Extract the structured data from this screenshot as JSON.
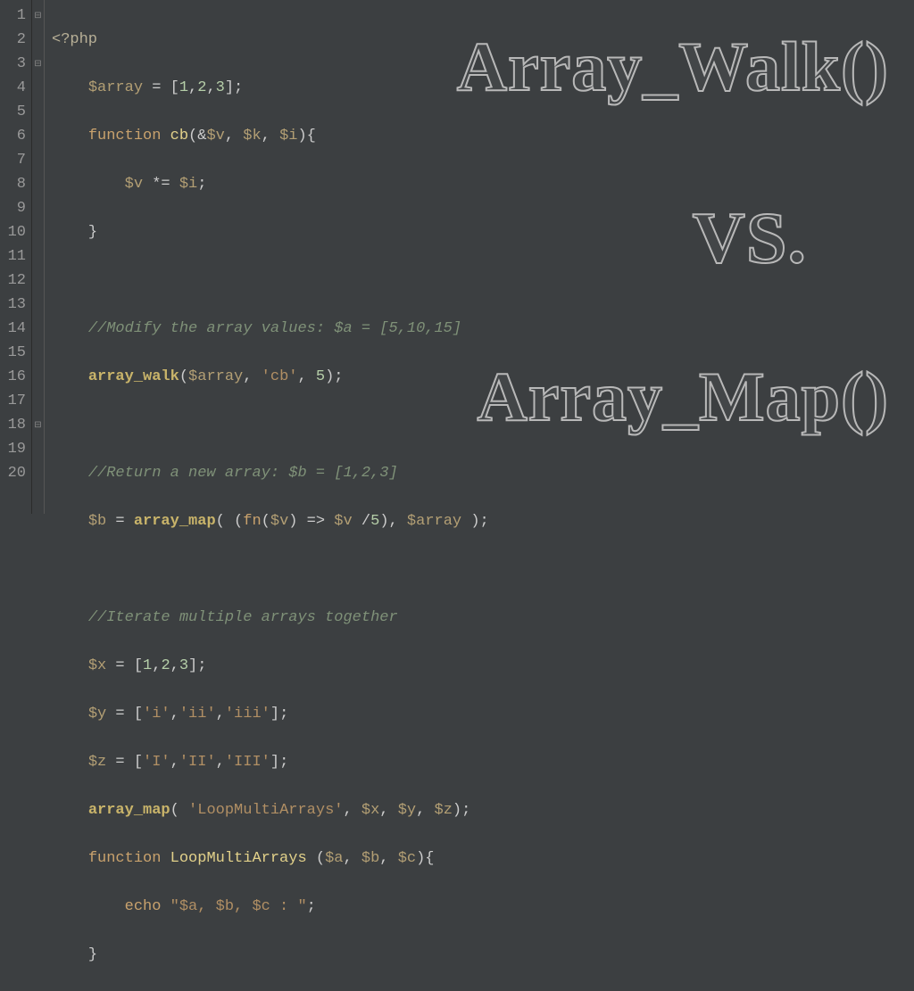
{
  "overlay": {
    "l1": "Array_Walk()",
    "l2": "VS.",
    "l3": "Array_Map()"
  },
  "gutter": [
    "1",
    "2",
    "3",
    "4",
    "5",
    "6",
    "7",
    "8",
    "9",
    "10",
    "11",
    "12",
    "13",
    "14",
    "15",
    "16",
    "17",
    "18",
    "19",
    "20"
  ],
  "fold": [
    "⊟",
    "",
    "⊟",
    "",
    "",
    "",
    "",
    "",
    "",
    "",
    "",
    "",
    "",
    "",
    "",
    "",
    "",
    "⊟",
    "",
    ""
  ],
  "code": {
    "l1": {
      "a": "<?php"
    },
    "l2": {
      "a": "$array",
      "b": " = [",
      "c": "1",
      "d": ",",
      "e": "2",
      "f": ",",
      "g": "3",
      "h": "];"
    },
    "l3": {
      "a": "function ",
      "b": "cb",
      "c": "(&",
      "d": "$v",
      "e": ", ",
      "f": "$k",
      "g": ", ",
      "h": "$i",
      "i": "){"
    },
    "l4": {
      "a": "$v",
      "b": " *= ",
      "c": "$i",
      "d": ";"
    },
    "l5": {
      "a": "}"
    },
    "l7": {
      "a": "//Modify the array values: $a = [5,10,15]"
    },
    "l8": {
      "a": "array_walk",
      "b": "(",
      "c": "$array",
      "d": ", ",
      "e": "'cb'",
      "f": ", ",
      "g": "5",
      "h": ");"
    },
    "l10": {
      "a": "//Return a new array: $b = [1,2,3]"
    },
    "l11": {
      "a": "$b",
      "b": " = ",
      "c": "array_map",
      "d": "( (",
      "e": "fn",
      "f": "(",
      "g": "$v",
      "h": ") => ",
      "i": "$v",
      "j": " /",
      "k": "5",
      "l": "), ",
      "m": "$array",
      "n": " );"
    },
    "l13": {
      "a": "//Iterate multiple arrays together"
    },
    "l14": {
      "a": "$x",
      "b": " = [",
      "c": "1",
      "d": ",",
      "e": "2",
      "f": ",",
      "g": "3",
      "h": "];"
    },
    "l15": {
      "a": "$y",
      "b": " = [",
      "c": "'i'",
      "d": ",",
      "e": "'ii'",
      "f": ",",
      "g": "'iii'",
      "h": "];"
    },
    "l16": {
      "a": "$z",
      "b": " = [",
      "c": "'I'",
      "d": ",",
      "e": "'II'",
      "f": ",",
      "g": "'III'",
      "h": "];"
    },
    "l17": {
      "a": "array_map",
      "b": "( ",
      "c": "'LoopMultiArrays'",
      "d": ", ",
      "e": "$x",
      "f": ", ",
      "g": "$y",
      "h": ", ",
      "i": "$z",
      "j": ");"
    },
    "l18": {
      "a": "function ",
      "b": "LoopMultiArrays ",
      "c": "(",
      "d": "$a",
      "e": ", ",
      "f": "$b",
      "g": ", ",
      "h": "$c",
      "i": "){"
    },
    "l19": {
      "a": "echo ",
      "b": "\"$a, $b, $c : \"",
      "c": ";"
    },
    "l20": {
      "a": "}"
    }
  }
}
